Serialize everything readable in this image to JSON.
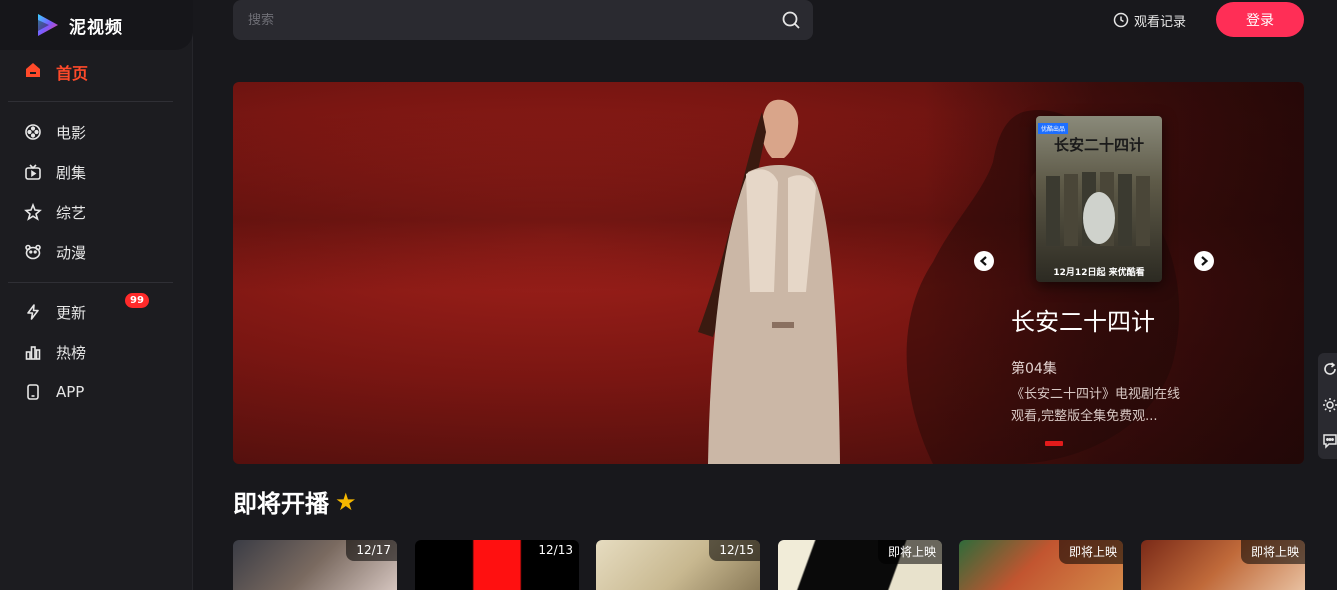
{
  "app": {
    "name": "泥视频"
  },
  "sidebar": {
    "home": {
      "label": "首页",
      "icon": "home-icon"
    },
    "items": [
      {
        "label": "电影",
        "icon": "film-reel-icon"
      },
      {
        "label": "剧集",
        "icon": "tv-icon"
      },
      {
        "label": "综艺",
        "icon": "star-outline-icon"
      },
      {
        "label": "动漫",
        "icon": "bear-face-icon"
      }
    ],
    "items2": [
      {
        "label": "更新",
        "icon": "lightning-icon",
        "badge": "99"
      },
      {
        "label": "热榜",
        "icon": "bar-chart-icon"
      },
      {
        "label": "APP",
        "icon": "phone-icon"
      }
    ]
  },
  "header": {
    "search_placeholder": "搜索",
    "history_label": "观看记录",
    "login_label": "登录"
  },
  "banner": {
    "title": "长安二十四计",
    "episode": "第04集",
    "description": "《长安二十四计》电视剧在线观看,完整版全集免费观...",
    "poster": {
      "title": "长安二十四计",
      "tag": "优酷出品",
      "date": "12月12日起 来优酷看"
    },
    "accent_color": "#e31b1b"
  },
  "section": {
    "title": "即将开播",
    "star": "★"
  },
  "cards": [
    {
      "label": "12/17"
    },
    {
      "label": "12/13"
    },
    {
      "label": "12/15"
    },
    {
      "label": "即将上映"
    },
    {
      "label": "即将上映"
    },
    {
      "label": "即将上映"
    }
  ],
  "colors": {
    "brand": "#ff2e56",
    "active": "#ff4a2a",
    "background": "#18181c"
  }
}
